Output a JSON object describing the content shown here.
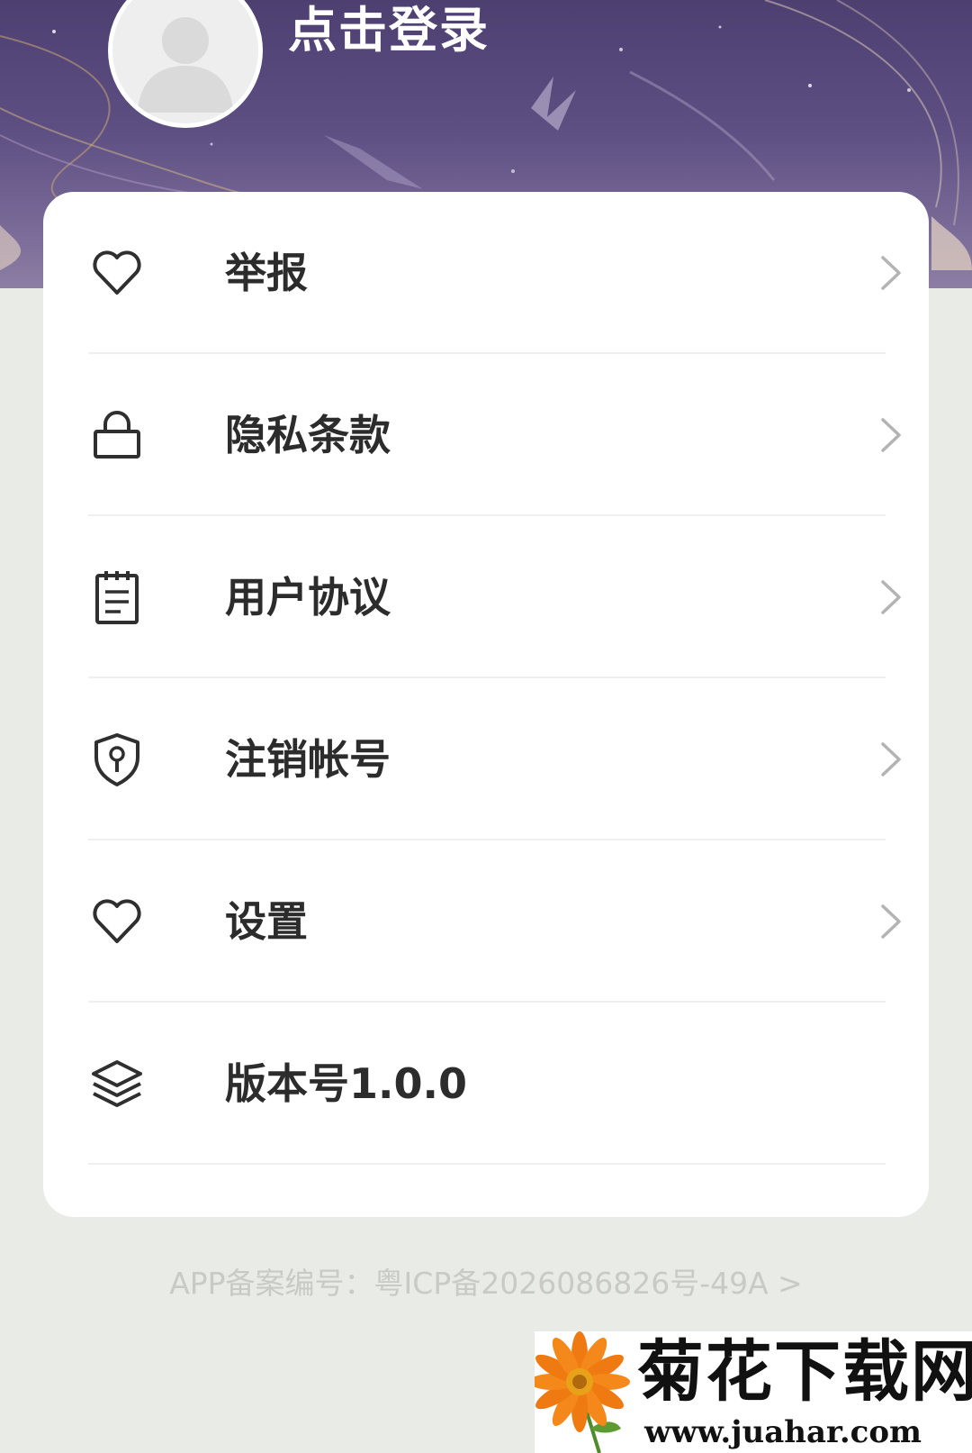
{
  "header": {
    "login_label": "点击登录"
  },
  "menu": {
    "items": [
      {
        "label": "举报",
        "icon": "heart-icon"
      },
      {
        "label": "隐私条款",
        "icon": "lock-icon"
      },
      {
        "label": "用户协议",
        "icon": "notepad-icon"
      },
      {
        "label": "注销帐号",
        "icon": "shield-key-icon"
      },
      {
        "label": "设置",
        "icon": "heart-icon"
      },
      {
        "label": "版本号1.0.0",
        "icon": "layers-icon"
      }
    ]
  },
  "footer": {
    "icp_text": "APP备案编号：粤ICP备2026086826号-49A >"
  },
  "watermark": {
    "name": "菊花下载网",
    "url": "www.juahar.com"
  },
  "colors": {
    "header_purple": "#5d4f82",
    "page_background": "#e9ebe6",
    "card_background": "#ffffff",
    "label_text": "#2c2c2c",
    "footer_text": "#c9cac5"
  }
}
